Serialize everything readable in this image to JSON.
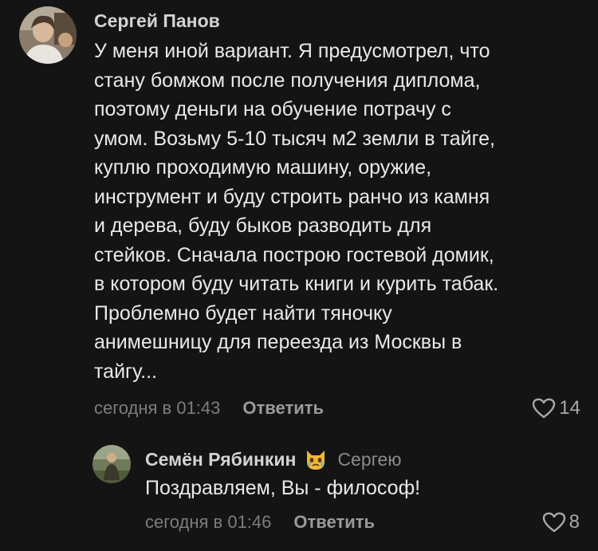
{
  "comments": [
    {
      "author": "Сергей Панов",
      "text": "У меня иной вариант. Я предусмотрел, что\nстану бомжом после получения диплома,\nпоэтому деньги на обучение потрачу с\nумом. Возьму 5-10 тысяч м2 земли в тайге,\nкуплю проходимую машину, оружие,\nинструмент и буду строить ранчо из камня\nи дерева, буду быков  разводить для\nстейков. Сначала построю гостевой домик,\nв котором буду читать книги и курить табак.\nПроблемно будет найти тяночку\nанимешницу для переезда из Москвы в\nтайгу...",
      "date": "сегодня в 01:43",
      "reply_label": "Ответить",
      "likes": "14"
    },
    {
      "author": "Семён Рябинкин",
      "badge_icon": "crying-cat-emoji-icon",
      "reply_to": "Сергею",
      "text": "Поздравляем, Вы - философ!",
      "date": "сегодня в 01:46",
      "reply_label": "Ответить",
      "likes": "8"
    }
  ],
  "colors": {
    "background": "#141414",
    "text": "#e9e9e9",
    "muted": "#7d7d7d"
  }
}
